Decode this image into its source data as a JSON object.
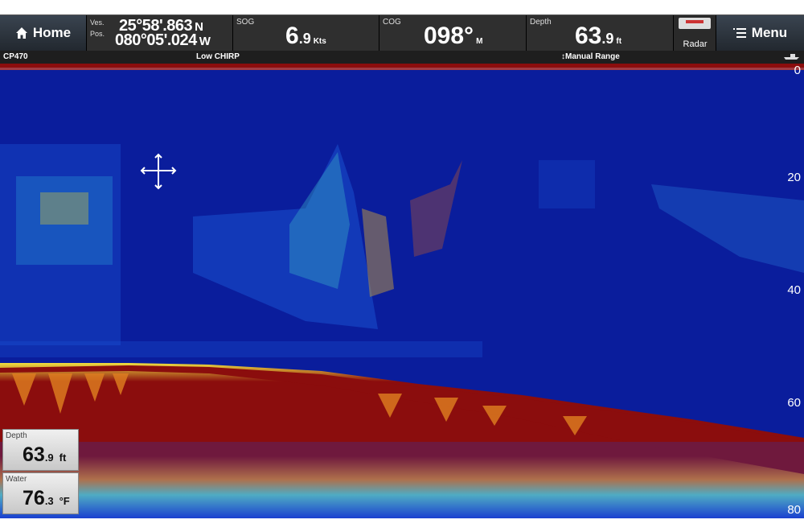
{
  "topbar": {
    "home_label": "Home",
    "position": {
      "label_line1": "Ves.",
      "label_line2": "Pos.",
      "lat": "25°58'.863",
      "lat_hem": "N",
      "lon": "080°05'.024",
      "lon_hem": "W"
    },
    "sog": {
      "label": "SOG",
      "value": "6",
      "decimal": ".9",
      "unit": "Kts"
    },
    "cog": {
      "label": "COG",
      "value": "098°",
      "unit": "M"
    },
    "depth": {
      "label": "Depth",
      "value": "63",
      "decimal": ".9",
      "unit": "ft"
    },
    "radar_label": "Radar",
    "menu_label": "Menu"
  },
  "status_strip": {
    "transducer": "CP470",
    "channel": "Low CHIRP",
    "range_mode": "Manual Range"
  },
  "depth_scale": {
    "ticks": [
      "0",
      "20",
      "40",
      "60",
      "80"
    ]
  },
  "panels": {
    "depth": {
      "label": "Depth",
      "value": "63",
      "decimal": ".9",
      "unit": "ft"
    },
    "water": {
      "label": "Water",
      "value": "76",
      "decimal": ".3",
      "unit": "°F"
    }
  },
  "colors": {
    "water_background": "#0a1d9c",
    "bottom_return": "#8b0d0d",
    "accent_topbar": "#3c3c3c"
  },
  "icons": [
    "home-icon",
    "menu-icon",
    "crosshair-icon",
    "boat-icon",
    "range-arrows-icon"
  ]
}
